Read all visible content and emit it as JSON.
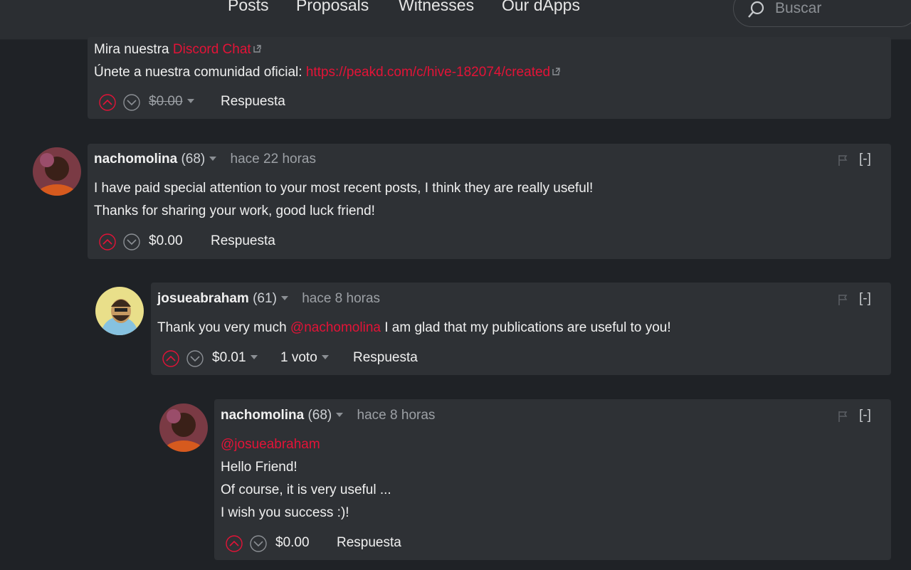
{
  "nav": {
    "items": [
      "Posts",
      "Proposals",
      "Witnesses",
      "Our dApps"
    ],
    "search_placeholder": "Buscar"
  },
  "colors": {
    "accent": "#e31337",
    "card": "#2e3135",
    "background": "#1f2226"
  },
  "comments": [
    {
      "lines": [
        {
          "prefix": "Mira nuestra ",
          "link": "Discord Chat"
        },
        {
          "prefix": "Únete a nuestra comunidad oficial: ",
          "link": "https://peakd.com/c/hive-182074/created"
        }
      ],
      "payout": "$0.00",
      "reply": "Respuesta"
    },
    {
      "author": "nachomolina",
      "rep": "(68)",
      "time": "hace 22 horas",
      "collapse": "[-]",
      "lines": [
        "I have paid special attention to your most recent posts, I think they are really useful!",
        "Thanks for sharing your work, good luck friend!"
      ],
      "payout": "$0.00",
      "reply": "Respuesta"
    },
    {
      "author": "josueabraham",
      "rep": "(61)",
      "time": "hace 8 horas",
      "collapse": "[-]",
      "body_before": "Thank you very much ",
      "mention": "@nachomolina",
      "body_after": " I am glad that my publications are useful to you!",
      "payout": "$0.01",
      "votes": "1 voto",
      "reply": "Respuesta"
    },
    {
      "author": "nachomolina",
      "rep": "(68)",
      "time": "hace 8 horas",
      "collapse": "[-]",
      "mention": "@josueabraham",
      "lines": [
        "Hello Friend!",
        "Of course, it is very useful ...",
        "I wish you success :)!"
      ],
      "payout": "$0.00",
      "reply": "Respuesta"
    }
  ]
}
